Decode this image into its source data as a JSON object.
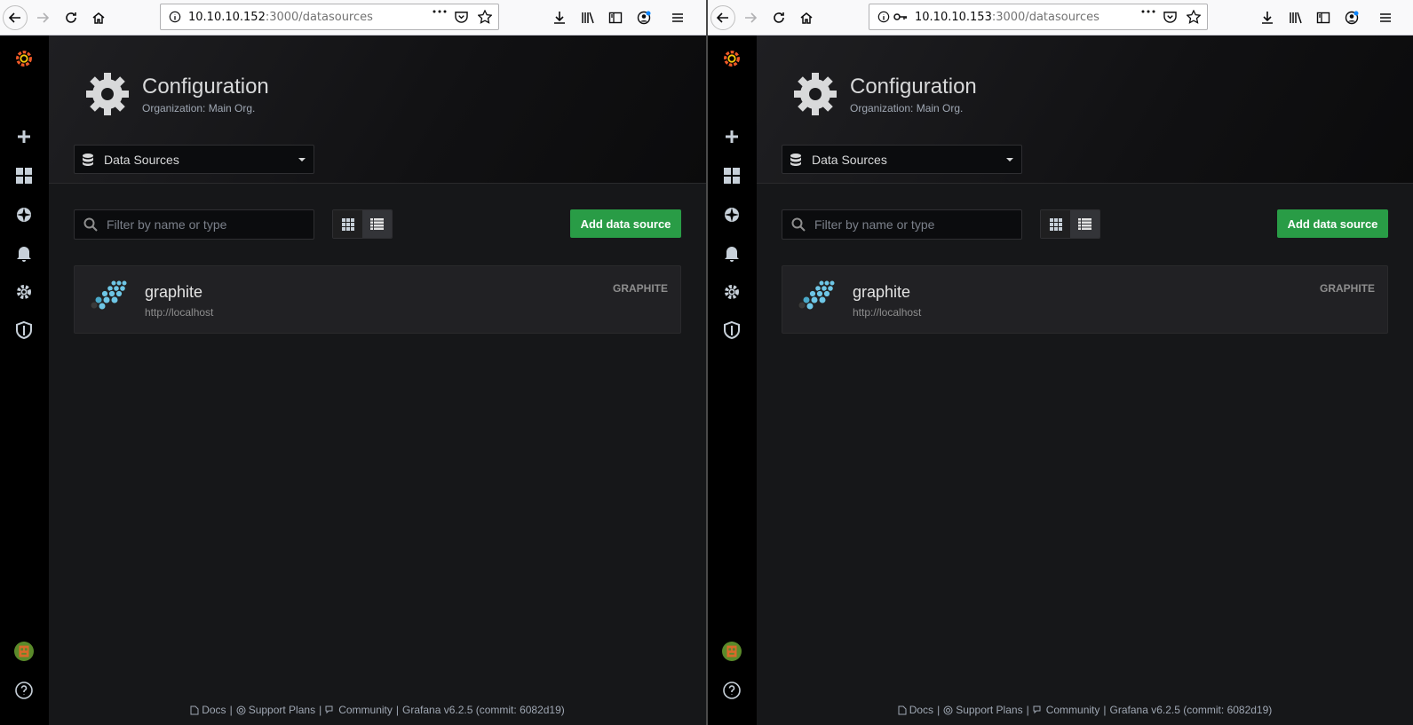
{
  "windows": [
    {
      "url_host": "10.10.10.152",
      "url_path": ":3000/datasources",
      "show_key": false
    },
    {
      "url_host": "10.10.10.153",
      "url_path": ":3000/datasources",
      "show_key": true
    }
  ],
  "page": {
    "title": "Configuration",
    "subtitle": "Organization: Main Org.",
    "section_dropdown": "Data Sources",
    "filter_placeholder": "Filter by name or type",
    "add_button": "Add data source"
  },
  "datasource": {
    "name": "graphite",
    "url": "http://localhost",
    "type": "GRAPHITE"
  },
  "footer": {
    "docs": "Docs",
    "support": "Support Plans",
    "community": "Community",
    "version": "Grafana v6.2.5 (commit: 6082d19)"
  },
  "colors": {
    "primary_button": "#299c46",
    "sidebar": "#000000",
    "background": "#161719"
  }
}
